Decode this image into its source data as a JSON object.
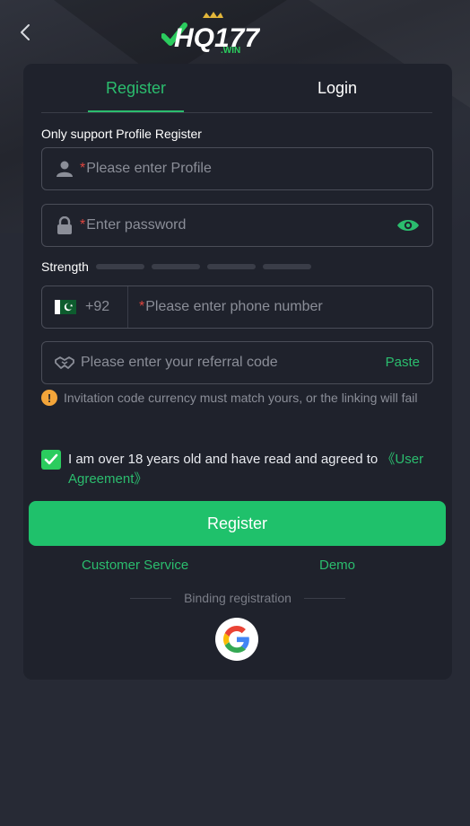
{
  "header": {
    "logo_text": "HQ177",
    "logo_sub": ".WIN"
  },
  "tabs": [
    {
      "label": "Register",
      "active": true
    },
    {
      "label": "Login",
      "active": false
    }
  ],
  "form": {
    "section_label": "Only support Profile Register",
    "required_mark": "*",
    "profile_placeholder": "Please enter Profile",
    "password_placeholder": "Enter password",
    "strength_label": "Strength",
    "country_code": "+92",
    "phone_placeholder": "Please enter phone number",
    "referral_placeholder": "Please enter your referral code",
    "paste_label": "Paste",
    "warning": "Invitation code currency must match yours, or the linking will fail",
    "agree_text": "I am over 18 years old and have read and agreed to ",
    "agree_link": "《User Agreement》",
    "agree_checked": true,
    "register_button": "Register"
  },
  "links": {
    "customer_service": "Customer Service",
    "demo": "Demo"
  },
  "binding": {
    "label": "Binding registration"
  },
  "icons": {
    "back": "chevron-left-icon",
    "user": "user-icon",
    "lock": "lock-icon",
    "eye": "eye-icon",
    "flag": "pakistan-flag-icon",
    "handshake": "handshake-icon",
    "warning": "warning-icon",
    "check": "check-icon",
    "google": "google-icon"
  },
  "colors": {
    "accent": "#2bbd6e",
    "button": "#1fc16b",
    "warning": "#f3a53a",
    "required": "#e0463f"
  }
}
